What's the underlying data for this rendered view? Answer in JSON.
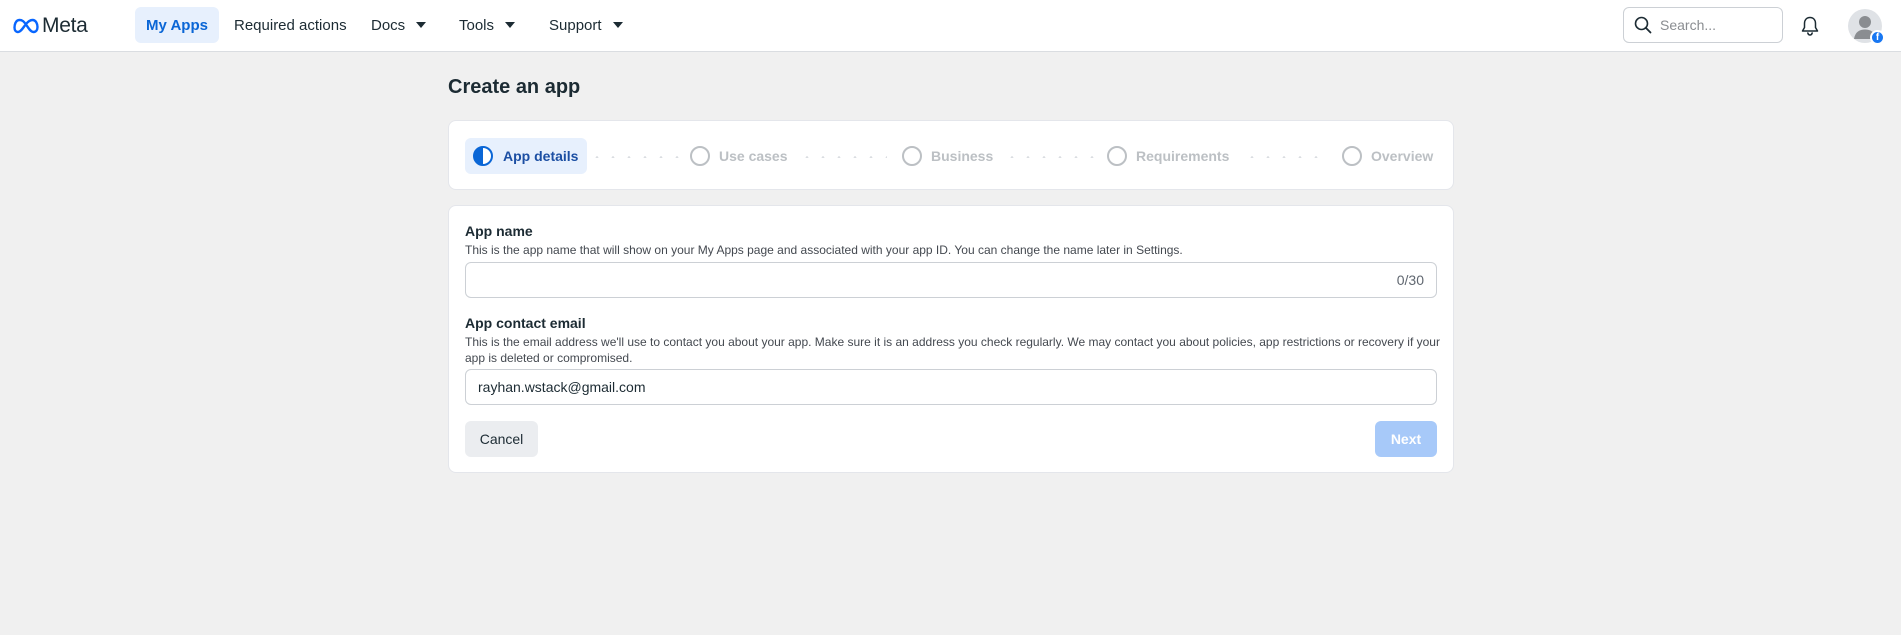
{
  "header": {
    "logo_text": "Meta",
    "nav": [
      {
        "label": "My Apps",
        "active": true
      },
      {
        "label": "Required actions"
      },
      {
        "label": "Docs",
        "dropdown": true
      },
      {
        "label": "Tools",
        "dropdown": true
      },
      {
        "label": "Support",
        "dropdown": true
      }
    ],
    "search_placeholder": "Search...",
    "avatar_badge": "f"
  },
  "page": {
    "title": "Create an app"
  },
  "stepper": {
    "steps": [
      {
        "label": "App details",
        "state": "active"
      },
      {
        "label": "Use cases",
        "state": "inactive"
      },
      {
        "label": "Business",
        "state": "inactive"
      },
      {
        "label": "Requirements",
        "state": "inactive"
      },
      {
        "label": "Overview",
        "state": "inactive"
      }
    ]
  },
  "form": {
    "app_name": {
      "label": "App name",
      "help": "This is the app name that will show on your My Apps page and associated with your app ID. You can change the name later in Settings.",
      "value": "",
      "counter": "0/30"
    },
    "app_email": {
      "label": "App contact email",
      "help": "This is the email address we'll use to contact you about your app. Make sure it is an address you check regularly. We may contact you about policies, app restrictions or recovery if your app is deleted or compromised.",
      "value": "rayhan.wstack@gmail.com"
    },
    "cancel_label": "Cancel",
    "next_label": "Next"
  },
  "colors": {
    "accent": "#0a66d6",
    "active_bg": "#e7f0fd",
    "next_disabled": "#a7c9f9",
    "page_bg": "#f0f0f0"
  }
}
